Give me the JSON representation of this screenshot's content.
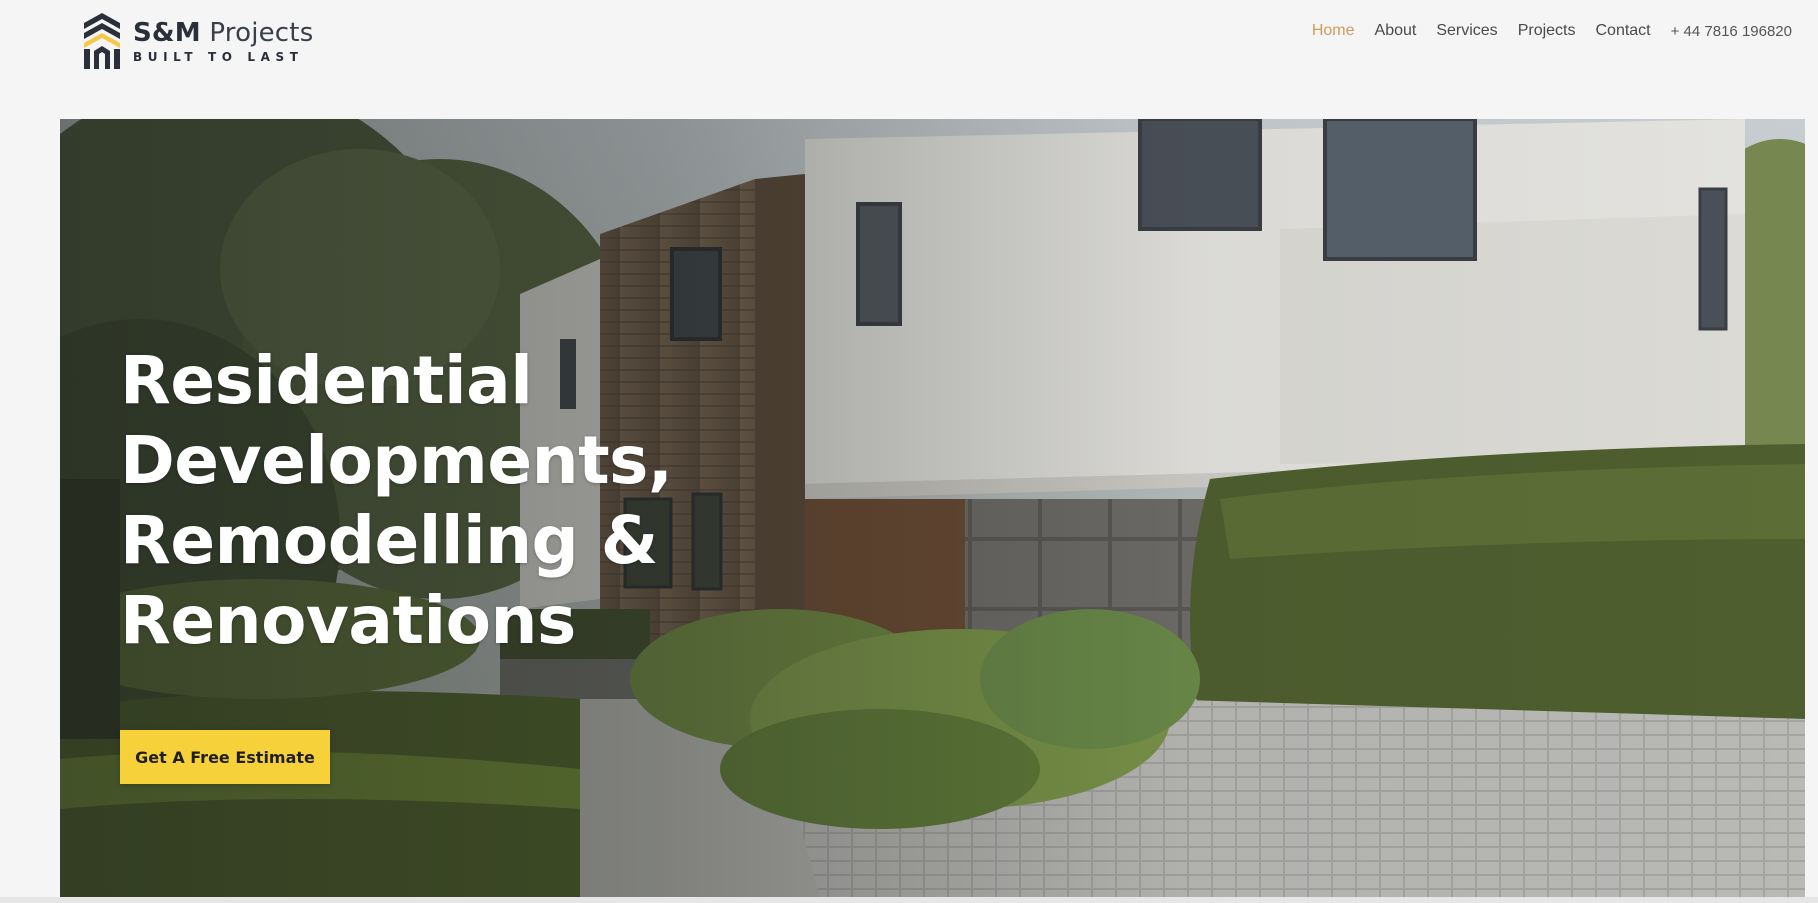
{
  "brand": {
    "name_bold": "S&M",
    "name_light": "Projects",
    "tagline": "BUILT TO LAST",
    "logo_icon": "house-chevron-logo-icon",
    "colors": {
      "dark": "#2a2f3a",
      "accent": "#f5c84a"
    }
  },
  "nav": {
    "items": [
      {
        "label": "Home",
        "active": true
      },
      {
        "label": "About",
        "active": false
      },
      {
        "label": "Services",
        "active": false
      },
      {
        "label": "Projects",
        "active": false
      },
      {
        "label": "Contact",
        "active": false
      }
    ],
    "phone": "+ 44 7816 196820",
    "active_color": "#d39a58"
  },
  "hero": {
    "title_lines": [
      "Residential",
      "Developments,",
      "Remodelling &",
      "Renovations"
    ],
    "cta_label": "Get A Free Estimate",
    "cta_color": "#f7d13a",
    "image": "modern-house-with-hedges"
  }
}
